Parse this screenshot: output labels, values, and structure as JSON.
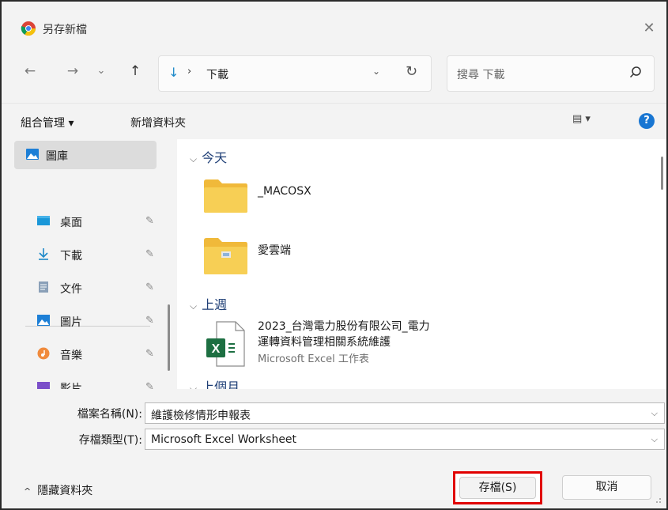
{
  "window": {
    "title": "另存新檔",
    "close_symbol": "✕"
  },
  "nav": {
    "back_icon": "←",
    "forward_icon": "→",
    "recent_icon": "⌄",
    "up_icon": "↑",
    "address": {
      "icon": "↓",
      "separator": "›",
      "path": "下載",
      "dropdown": "⌄",
      "refresh": "↻"
    },
    "search_placeholder": "搜尋 下載"
  },
  "toolbar": {
    "organize": "組合管理 ▾",
    "new_folder": "新增資料夾",
    "view": "▤ ▾",
    "help": "?"
  },
  "sidebar": {
    "items": [
      {
        "label": "圖庫",
        "icon": "gallery-icon",
        "selected": true,
        "pinned": false
      },
      {
        "label": "桌面",
        "icon": "desktop-icon",
        "pinned": true
      },
      {
        "label": "下載",
        "icon": "download-icon",
        "pinned": true
      },
      {
        "label": "文件",
        "icon": "document-icon",
        "pinned": true
      },
      {
        "label": "圖片",
        "icon": "pictures-icon",
        "pinned": true
      },
      {
        "label": "音樂",
        "icon": "music-icon",
        "pinned": true
      },
      {
        "label": "影片",
        "icon": "videos-icon",
        "pinned": true
      }
    ],
    "pin_symbol": "📌"
  },
  "main": {
    "groups": [
      {
        "header": "今天",
        "files": [
          {
            "name": "_MACOSX",
            "type": "folder"
          },
          {
            "name": "愛雲端",
            "type": "folder"
          }
        ]
      },
      {
        "header": "上週",
        "files": [
          {
            "name_line1": "2023_台灣電力股份有限公司_電力",
            "name_line2": "運轉資料管理相關系統維護",
            "sub": "Microsoft Excel 工作表",
            "type": "excel"
          }
        ]
      },
      {
        "header": "上個月",
        "files": []
      }
    ],
    "chevron": "⌵"
  },
  "form": {
    "filename_label": "檔案名稱(N):",
    "filename_value": "維護檢修情形申報表",
    "filetype_label": "存檔類型(T):",
    "filetype_value": "Microsoft Excel Worksheet",
    "dropdown": "⌵"
  },
  "footer": {
    "hide_folders": "隱藏資料夾",
    "caret": "^",
    "save": "存檔(S)",
    "cancel": "取消"
  },
  "colors": {
    "highlight": "#e10000",
    "help": "#1976d2",
    "group_header": "#1f3f76",
    "excel_green": "#1d6f42",
    "folder_yellow": "#f5c94a"
  }
}
